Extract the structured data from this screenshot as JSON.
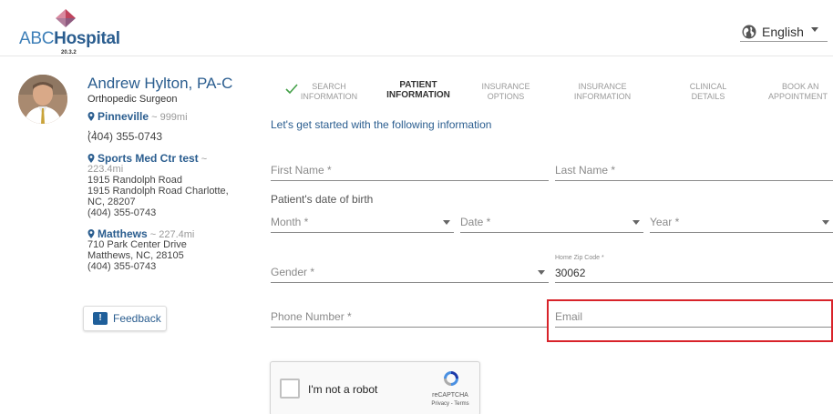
{
  "header": {
    "logo_prefix": "ABC",
    "logo_suffix": "Hospital",
    "version": "20.3.2",
    "language": "English"
  },
  "doctor": {
    "name": "Andrew Hylton, PA-C",
    "specialty": "Orthopedic Surgeon",
    "locations": [
      {
        "name": "Pinneville",
        "distance": "~ 999mi",
        "address1": ", ,",
        "address2": "",
        "address3": "",
        "phone": "(404) 355-0743"
      },
      {
        "name": "Sports Med Ctr test",
        "distance": "~",
        "distance2": "223.4mi",
        "address1": "1915 Randolph Road",
        "address2": "1915 Randolph Road Charlotte,",
        "address3": "NC, 28207",
        "phone": "(404) 355-0743"
      },
      {
        "name": "Matthews",
        "distance": "~ 227.4mi",
        "address1": "710 Park Center Drive",
        "address2": "Matthews, NC, 28105",
        "address3": "",
        "phone": "(404) 355-0743"
      }
    ],
    "feedback_label": "Feedback"
  },
  "steps": [
    {
      "line1": "SEARCH",
      "line2": "INFORMATION"
    },
    {
      "line1": "PATIENT",
      "line2": "INFORMATION"
    },
    {
      "line1": "INSURANCE",
      "line2": "OPTIONS"
    },
    {
      "line1": "INSURANCE",
      "line2": "INFORMATION"
    },
    {
      "line1": "CLINICAL",
      "line2": "DETAILS"
    },
    {
      "line1": "BOOK AN",
      "line2": "APPOINTMENT"
    }
  ],
  "form": {
    "intro": "Let's get started with the following information",
    "first_name": "First Name *",
    "last_name": "Last Name *",
    "dob_label": "Patient's date of birth",
    "month": "Month *",
    "date": "Date *",
    "year": "Year *",
    "gender": "Gender *",
    "zip_label": "Home Zip Code *",
    "zip_value": "30062",
    "phone": "Phone Number *",
    "email": "Email"
  },
  "captcha": {
    "label": "I'm not a robot",
    "brand": "reCAPTCHA",
    "links": "Privacy - Terms"
  },
  "colors": {
    "brand_blue": "#2a5d8f",
    "highlight_red": "#d8232a",
    "logo_diamond": "#c46a8a"
  }
}
